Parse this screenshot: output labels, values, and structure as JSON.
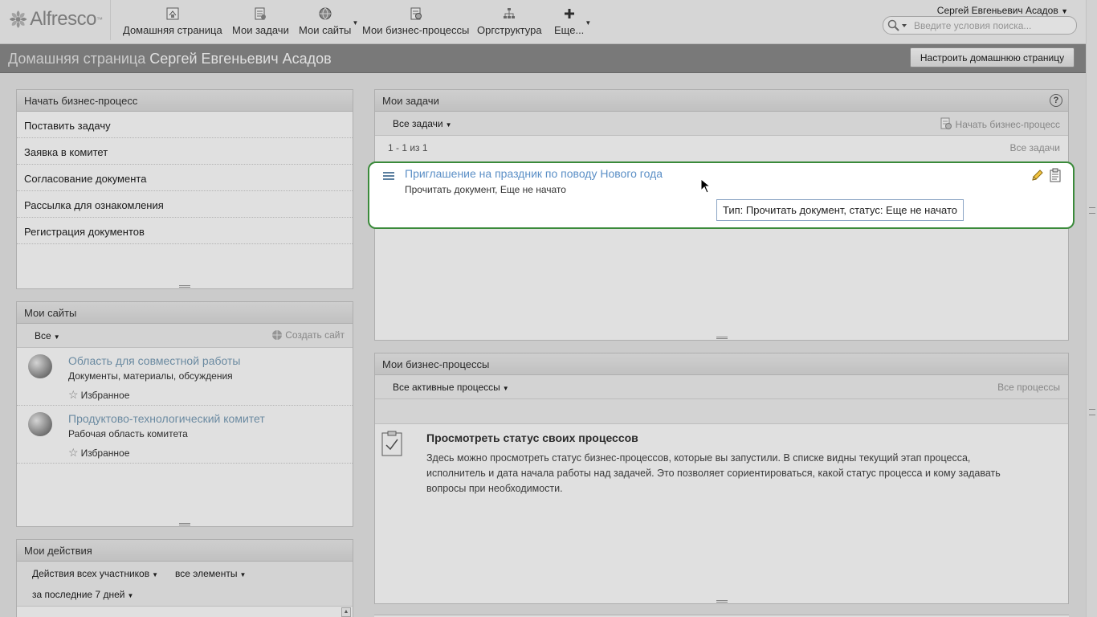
{
  "header": {
    "logo_text": "Alfresco",
    "logo_tm": "™",
    "nav": [
      {
        "label": "Домашняя страница"
      },
      {
        "label": "Мои задачи"
      },
      {
        "label": "Мои сайты"
      },
      {
        "label": "Мои бизнес-процессы"
      },
      {
        "label": "Оргструктура"
      },
      {
        "label": "Еще..."
      }
    ],
    "user_name": "Сергей Евгеньевич Асадов",
    "search_placeholder": "Введите условия поиска..."
  },
  "title_bar": {
    "title_prefix": "Домашняя страница",
    "title_user": "Сергей Евгеньевич Асадов",
    "customize_label": "Настроить домашнюю страницу"
  },
  "start_workflow": {
    "title": "Начать бизнес-процесс",
    "items": [
      "Поставить задачу",
      "Заявка в комитет",
      "Согласование документа",
      "Рассылка для ознакомления",
      "Регистрация документов"
    ]
  },
  "my_sites": {
    "title": "Мои сайты",
    "filter": "Все",
    "create_label": "Создать сайт",
    "sites": [
      {
        "name": "Область для совместной работы",
        "description": "Документы, материалы, обсуждения",
        "favorite_label": "Избранное"
      },
      {
        "name": "Продуктово-технологический комитет",
        "description": "Рабочая область комитета",
        "favorite_label": "Избранное"
      }
    ]
  },
  "my_activities": {
    "title": "Мои действия",
    "filter_users": "Действия всех участников",
    "filter_items": "все элементы",
    "filter_period": "за последние 7 дней"
  },
  "my_tasks": {
    "title": "Мои задачи",
    "help": "?",
    "filter": "Все задачи",
    "start_workflow_label": "Начать бизнес-процесс",
    "pagination": "1 - 1 из 1",
    "all_tasks_link": "Все задачи",
    "task": {
      "title": "Приглашение на праздник по поводу Нового года",
      "subtitle": "Прочитать документ, Еще не начато",
      "tooltip": "Тип: Прочитать документ, статус: Еще не начато"
    }
  },
  "my_workflows": {
    "title": "Мои бизнес-процессы",
    "filter": "Все активные процессы",
    "all_link": "Все процессы",
    "empty_title": "Просмотреть статус своих процессов",
    "empty_text": "Здесь можно просмотреть статус бизнес-процессов, которые вы запустили. В списке видны текущий этап процесса, исполнитель и дата начала работы над задачей. Это позволяет сориентироваться, какой статус процесса и кому задавать вопросы при необходимости."
  }
}
